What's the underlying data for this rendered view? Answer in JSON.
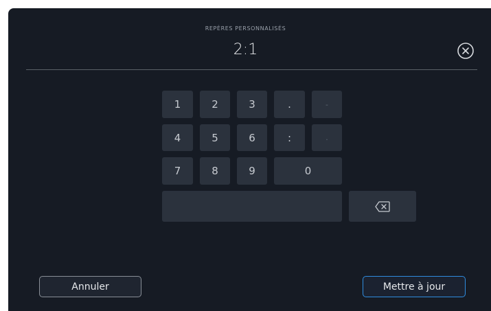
{
  "header": {
    "subtitle": "REPÈRES PERSONNALISÉS",
    "value": "2:1",
    "close_icon": "close-circle-icon"
  },
  "keypad": {
    "row1": [
      "1",
      "2",
      "3",
      ".",
      "-"
    ],
    "row2": [
      "4",
      "5",
      "6",
      ":",
      "."
    ],
    "row3": [
      "7",
      "8",
      "9",
      "0"
    ],
    "backspace_icon": "backspace-icon",
    "space_label": ""
  },
  "footer": {
    "cancel_label": "Annuler",
    "update_label": "Mettre à jour"
  },
  "colors": {
    "panel_bg": "#161b24",
    "key_bg": "#2b323d",
    "accent": "#2f8de0"
  }
}
